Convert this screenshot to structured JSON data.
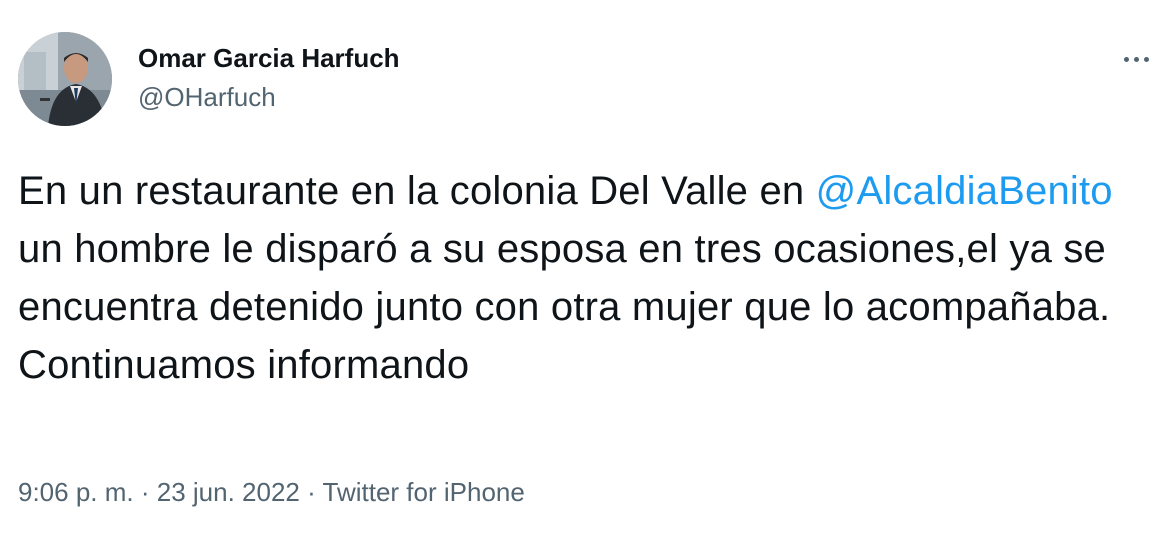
{
  "author": {
    "display_name": "Omar Garcia Harfuch",
    "handle": "@OHarfuch"
  },
  "more_icon": "more-horizontal-icon",
  "tweet": {
    "text_before": "En un restaurante en la colonia Del Valle en ",
    "mention": "@AlcaldiaBenito",
    "text_after": " un hombre le disparó a su esposa en tres ocasiones,el ya se encuentra detenido junto con otra mujer que lo acompañaba. Continuamos informando"
  },
  "meta": {
    "time": "9:06 p. m.",
    "separator": " · ",
    "date": "23 jun. 2022",
    "source": "Twitter for iPhone"
  },
  "colors": {
    "text": "#0f1419",
    "secondary": "#536471",
    "link": "#1d9bf0"
  }
}
